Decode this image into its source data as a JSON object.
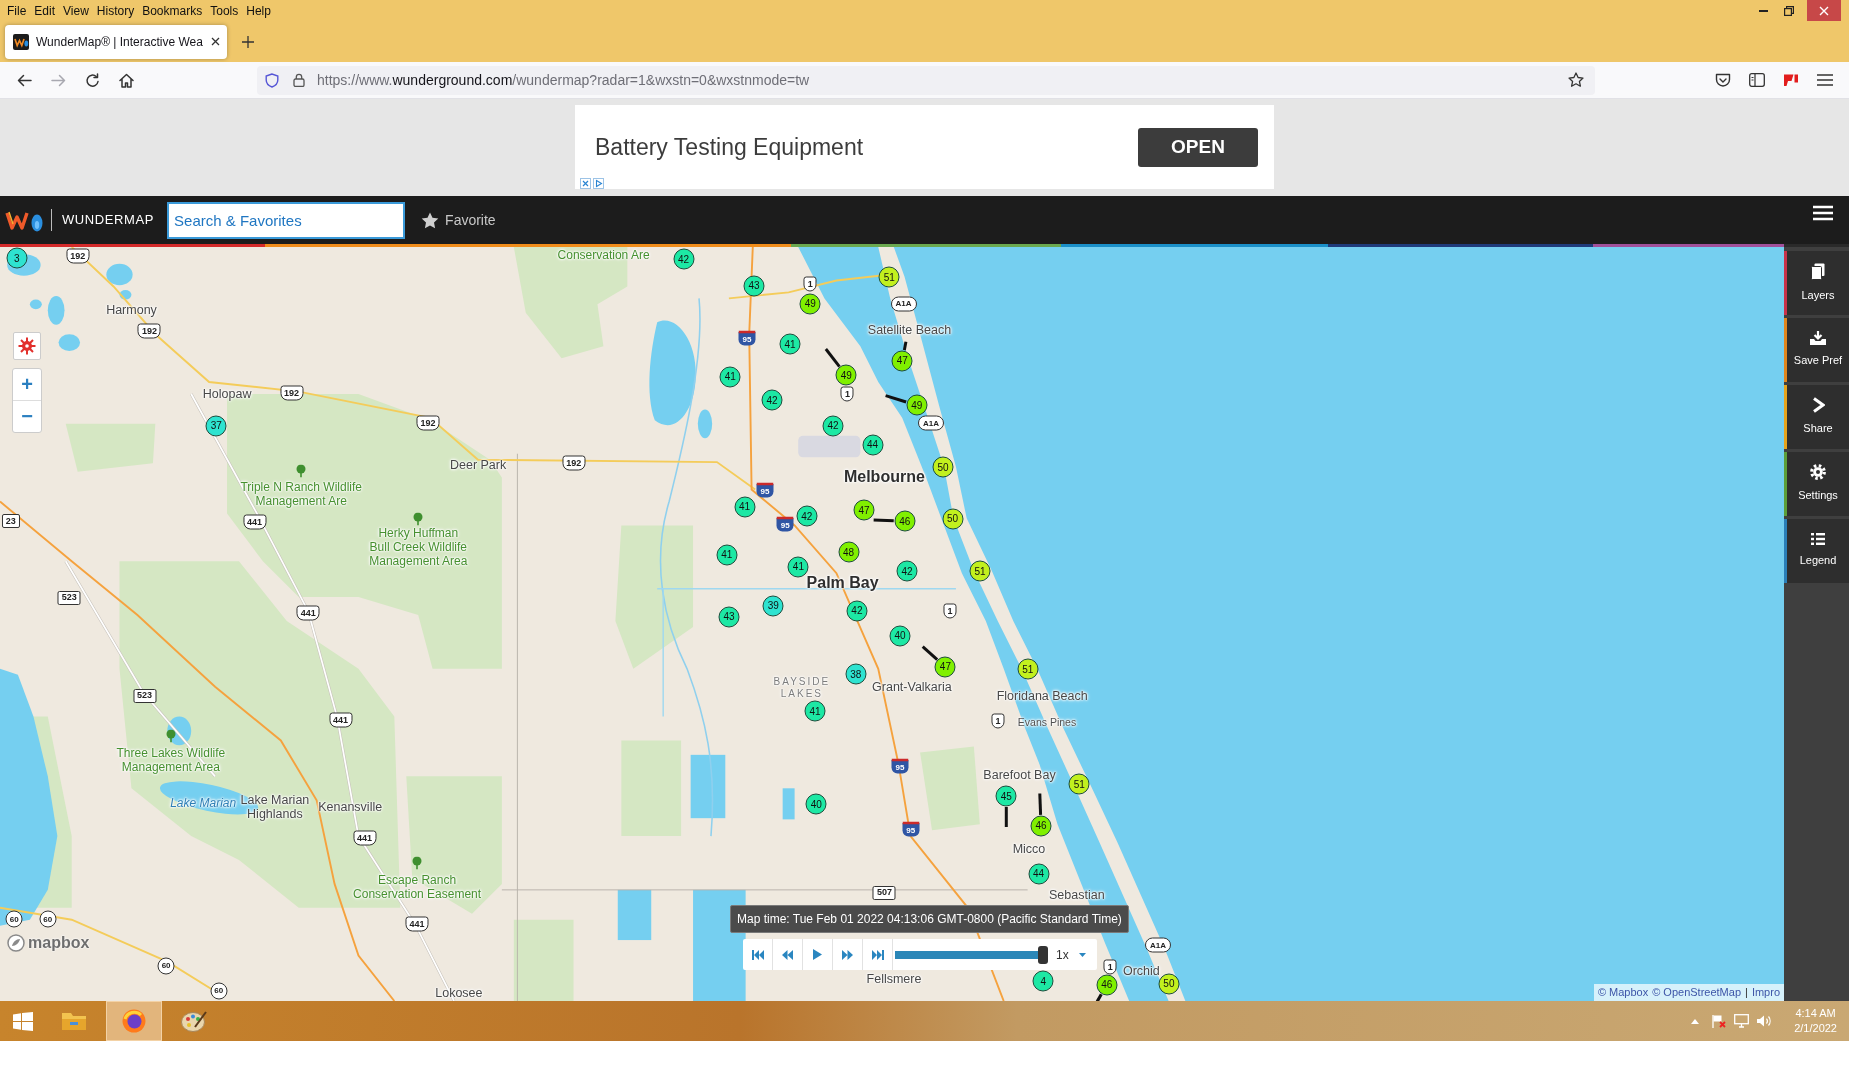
{
  "menu": [
    "File",
    "Edit",
    "View",
    "History",
    "Bookmarks",
    "Tools",
    "Help"
  ],
  "tabs": [
    {
      "title": "WunderMap® | Interactive Wea",
      "selected": true
    }
  ],
  "address_bar": {
    "prefix": "https://www.",
    "domain": "wunderground.com",
    "path": "/wundermap?radar=1&wxstn=0&wxstnmode=tw"
  },
  "ad": {
    "headline": "Battery Testing Equipment",
    "button": "OPEN"
  },
  "app_bar": {
    "brand": "WUNDERMAP",
    "search": {
      "placeholder": "Search & Favorites"
    },
    "favorite": "Favorite"
  },
  "map": {
    "zoom_in": "+",
    "zoom_out": "−",
    "places": [
      {
        "label": "Conservation Are",
        "kind": "park"
      },
      {
        "label": "Harmony",
        "kind": "town"
      },
      {
        "label": "Holopaw",
        "kind": "town"
      },
      {
        "label": "Deer Park",
        "kind": "town"
      },
      {
        "label": "Triple N Ranch Wildlife\nManagement Are",
        "kind": "park"
      },
      {
        "label": "Herky Huffman\nBull Creek Wildlife\nManagement Area",
        "kind": "park"
      },
      {
        "label": "Three Lakes Wildlife\nManagement Area",
        "kind": "park"
      },
      {
        "label": "Lake Marian",
        "kind": "water"
      },
      {
        "label": "Lake Marian\nHighlands",
        "kind": "town"
      },
      {
        "label": "Kenansville",
        "kind": "town"
      },
      {
        "label": "Escape Ranch\nConservation Easement",
        "kind": "park"
      },
      {
        "label": "Lokosee",
        "kind": "town"
      },
      {
        "label": "Satellite Beach",
        "kind": "town"
      },
      {
        "label": "Melbourne",
        "kind": "city"
      },
      {
        "label": "Palm Bay",
        "kind": "city"
      },
      {
        "label": "BAYSIDE\nLAKES",
        "kind": "district"
      },
      {
        "label": "Grant-Valkaria",
        "kind": "town"
      },
      {
        "label": "Floridana Beach",
        "kind": "town"
      },
      {
        "label": "Evans Pines",
        "kind": "minor"
      },
      {
        "label": "Barefoot Bay",
        "kind": "town"
      },
      {
        "label": "Micco",
        "kind": "town"
      },
      {
        "label": "Sebastian",
        "kind": "town"
      },
      {
        "label": "Fellsmere",
        "kind": "town"
      },
      {
        "label": "Orchid",
        "kind": "town"
      }
    ],
    "road_shields": [
      {
        "label": "192",
        "kind": "us"
      },
      {
        "label": "192",
        "kind": "us"
      },
      {
        "label": "192",
        "kind": "us"
      },
      {
        "label": "192",
        "kind": "us"
      },
      {
        "label": "192",
        "kind": "us"
      },
      {
        "label": "441",
        "kind": "us"
      },
      {
        "label": "441",
        "kind": "us"
      },
      {
        "label": "441",
        "kind": "us"
      },
      {
        "label": "441",
        "kind": "us"
      },
      {
        "label": "441",
        "kind": "us"
      },
      {
        "label": "523",
        "kind": "county"
      },
      {
        "label": "523",
        "kind": "county"
      },
      {
        "label": "23",
        "kind": "county"
      },
      {
        "label": "60",
        "kind": "state"
      },
      {
        "label": "60",
        "kind": "state"
      },
      {
        "label": "60",
        "kind": "state"
      },
      {
        "label": "60",
        "kind": "state"
      },
      {
        "label": "507",
        "kind": "county"
      },
      {
        "label": "1",
        "kind": "us"
      },
      {
        "label": "1",
        "kind": "us"
      },
      {
        "label": "1",
        "kind": "us"
      },
      {
        "label": "1",
        "kind": "us"
      },
      {
        "label": "1",
        "kind": "us"
      },
      {
        "label": "A1A",
        "kind": "oval"
      },
      {
        "label": "A1A",
        "kind": "oval"
      },
      {
        "label": "A1A",
        "kind": "oval"
      },
      {
        "label": "95",
        "kind": "interstate"
      },
      {
        "label": "95",
        "kind": "interstate"
      },
      {
        "label": "95",
        "kind": "interstate"
      },
      {
        "label": "95",
        "kind": "interstate"
      },
      {
        "label": "95",
        "kind": "interstate"
      }
    ],
    "stations": [
      {
        "reading": "3",
        "color": "#2ee3d0"
      },
      {
        "reading": "37",
        "color": "#2ee3d0"
      },
      {
        "reading": "42",
        "color": "#1de8a4"
      },
      {
        "reading": "43",
        "color": "#1de8a4"
      },
      {
        "reading": "49",
        "color": "#80f000"
      },
      {
        "reading": "51",
        "color": "#c2f01e"
      },
      {
        "reading": "41",
        "color": "#1de8a4"
      },
      {
        "reading": "41",
        "color": "#1de8a4"
      },
      {
        "reading": "49",
        "color": "#80f000"
      },
      {
        "reading": "47",
        "color": "#80f000"
      },
      {
        "reading": "42",
        "color": "#1de8a4"
      },
      {
        "reading": "49",
        "color": "#80f000"
      },
      {
        "reading": "42",
        "color": "#1de8a4"
      },
      {
        "reading": "44",
        "color": "#1de8a4"
      },
      {
        "reading": "50",
        "color": "#c2f01e"
      },
      {
        "reading": "41",
        "color": "#1de8a4"
      },
      {
        "reading": "42",
        "color": "#1de8a4"
      },
      {
        "reading": "47",
        "color": "#80f000"
      },
      {
        "reading": "46",
        "color": "#80f000"
      },
      {
        "reading": "50",
        "color": "#c2f01e"
      },
      {
        "reading": "41",
        "color": "#1de8a4"
      },
      {
        "reading": "41",
        "color": "#1de8a4"
      },
      {
        "reading": "48",
        "color": "#80f000"
      },
      {
        "reading": "42",
        "color": "#1de8a4"
      },
      {
        "reading": "51",
        "color": "#c2f01e"
      },
      {
        "reading": "39",
        "color": "#2ee3d0"
      },
      {
        "reading": "43",
        "color": "#1de8a4"
      },
      {
        "reading": "42",
        "color": "#1de8a4"
      },
      {
        "reading": "40",
        "color": "#1de8a4"
      },
      {
        "reading": "47",
        "color": "#80f000"
      },
      {
        "reading": "51",
        "color": "#c2f01e"
      },
      {
        "reading": "38",
        "color": "#2ee3d0"
      },
      {
        "reading": "41",
        "color": "#1de8a4"
      },
      {
        "reading": "40",
        "color": "#1de8a4"
      },
      {
        "reading": "51",
        "color": "#c2f01e"
      },
      {
        "reading": "45",
        "color": "#1de8a4"
      },
      {
        "reading": "46",
        "color": "#80f000"
      },
      {
        "reading": "44",
        "color": "#1de8a4"
      },
      {
        "reading": "4",
        "color": "#1de8a4"
      },
      {
        "reading": "46",
        "color": "#80f000"
      },
      {
        "reading": "50",
        "color": "#c2f01e"
      }
    ],
    "logo": "mapbox",
    "attribution": [
      {
        "text": "© Mapbox",
        "kind": "link"
      },
      {
        "text": "© OpenStreetMap",
        "kind": "link"
      },
      {
        "text": "|",
        "kind": "separator"
      },
      {
        "text": "Impro",
        "kind": "link"
      }
    ]
  },
  "playback": {
    "map_time": "Map time: Tue Feb 01 2022 04:13:06 GMT-0800 (Pacific Standard Time)",
    "level": 1,
    "speed": "1x"
  },
  "sidebar": {
    "buttons": [
      {
        "label": "Layers",
        "color": "#c8324a"
      },
      {
        "label": "Save Pref",
        "color": "#e0861e"
      },
      {
        "label": "Share",
        "color": "#e6a41c"
      },
      {
        "label": "Settings",
        "color": "#5c9e3a"
      },
      {
        "label": "Legend",
        "color": "#2a7fb8"
      }
    ]
  },
  "taskbar": {
    "apps": [
      {
        "selected": false
      },
      {
        "selected": true
      },
      {
        "selected": false
      }
    ],
    "time": "4:14 AM",
    "date": "2/1/2022"
  }
}
